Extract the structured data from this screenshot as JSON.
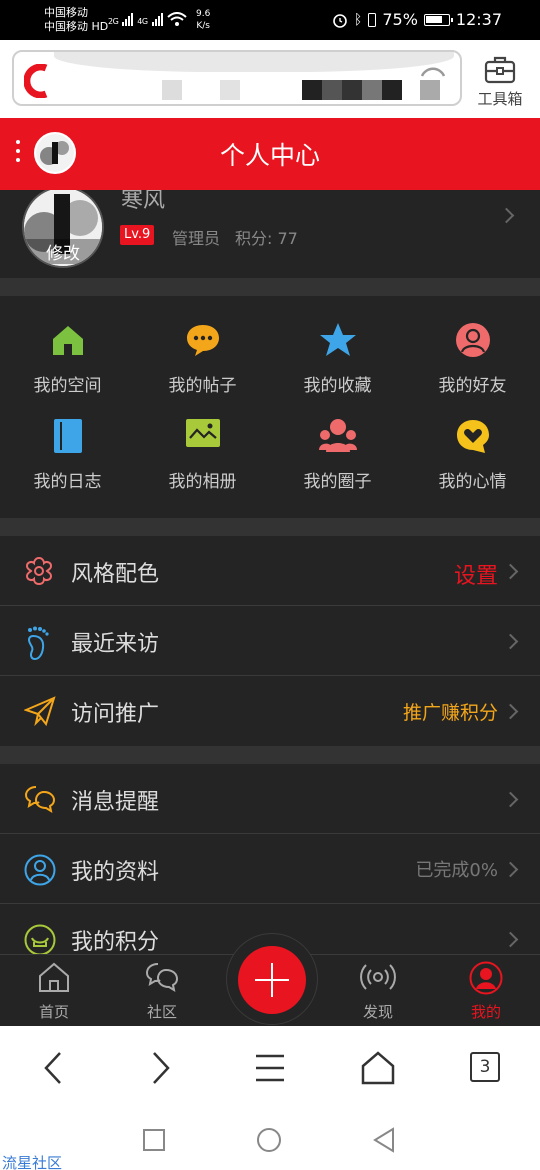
{
  "status_bar": {
    "carrier_1": "中国移动",
    "carrier_2": "中国移动 HD",
    "net_1": "2G",
    "net_2": "4G",
    "speed_value": "9.6",
    "speed_unit": "K/s",
    "battery": "75%",
    "time": "12:37"
  },
  "browser": {
    "toolbox_label": "工具箱",
    "tabs_count": "3"
  },
  "header": {
    "title": "个人中心"
  },
  "profile": {
    "name": "寒风",
    "avatar_text": "寒风",
    "edit_label": "修改",
    "level": "Lv.9",
    "role": "管理员",
    "points": "积分: 77"
  },
  "grid": [
    {
      "label": "我的空间",
      "icon": "home-icon",
      "color": "#7cc13f"
    },
    {
      "label": "我的帖子",
      "icon": "chat-bubble-icon",
      "color": "#f4a61a"
    },
    {
      "label": "我的收藏",
      "icon": "star-icon",
      "color": "#3ea6e8"
    },
    {
      "label": "我的好友",
      "icon": "person-icon",
      "color": "#ef6b6b"
    },
    {
      "label": "我的日志",
      "icon": "notebook-icon",
      "color": "#3ea6e8"
    },
    {
      "label": "我的相册",
      "icon": "photo-icon",
      "color": "#a8c93a"
    },
    {
      "label": "我的圈子",
      "icon": "group-icon",
      "color": "#ef6b6b"
    },
    {
      "label": "我的心情",
      "icon": "heart-bubble-icon",
      "color": "#f4c21a"
    }
  ],
  "list1": [
    {
      "label": "风格配色",
      "right": "设置",
      "right_color": "#e8141f",
      "icon": "flower-icon"
    },
    {
      "label": "最近来访",
      "right": "",
      "icon": "footprint-icon"
    },
    {
      "label": "访问推广",
      "right": "推广赚积分",
      "right_color": "#f4a61a",
      "icon": "paper-plane-icon"
    }
  ],
  "list2": [
    {
      "label": "消息提醒",
      "right": "",
      "icon": "message-icon"
    },
    {
      "label": "我的资料",
      "right": "已完成0%",
      "right_color": "#777777",
      "icon": "user-circle-icon"
    },
    {
      "label": "我的积分",
      "right": "",
      "icon": "coin-icon"
    }
  ],
  "bottom_nav": {
    "home": "首页",
    "community": "社区",
    "discover": "发现",
    "me": "我的"
  },
  "watermark": "流星社区",
  "colors": {
    "brand_red": "#e8141f",
    "bg_dark": "#242424"
  }
}
